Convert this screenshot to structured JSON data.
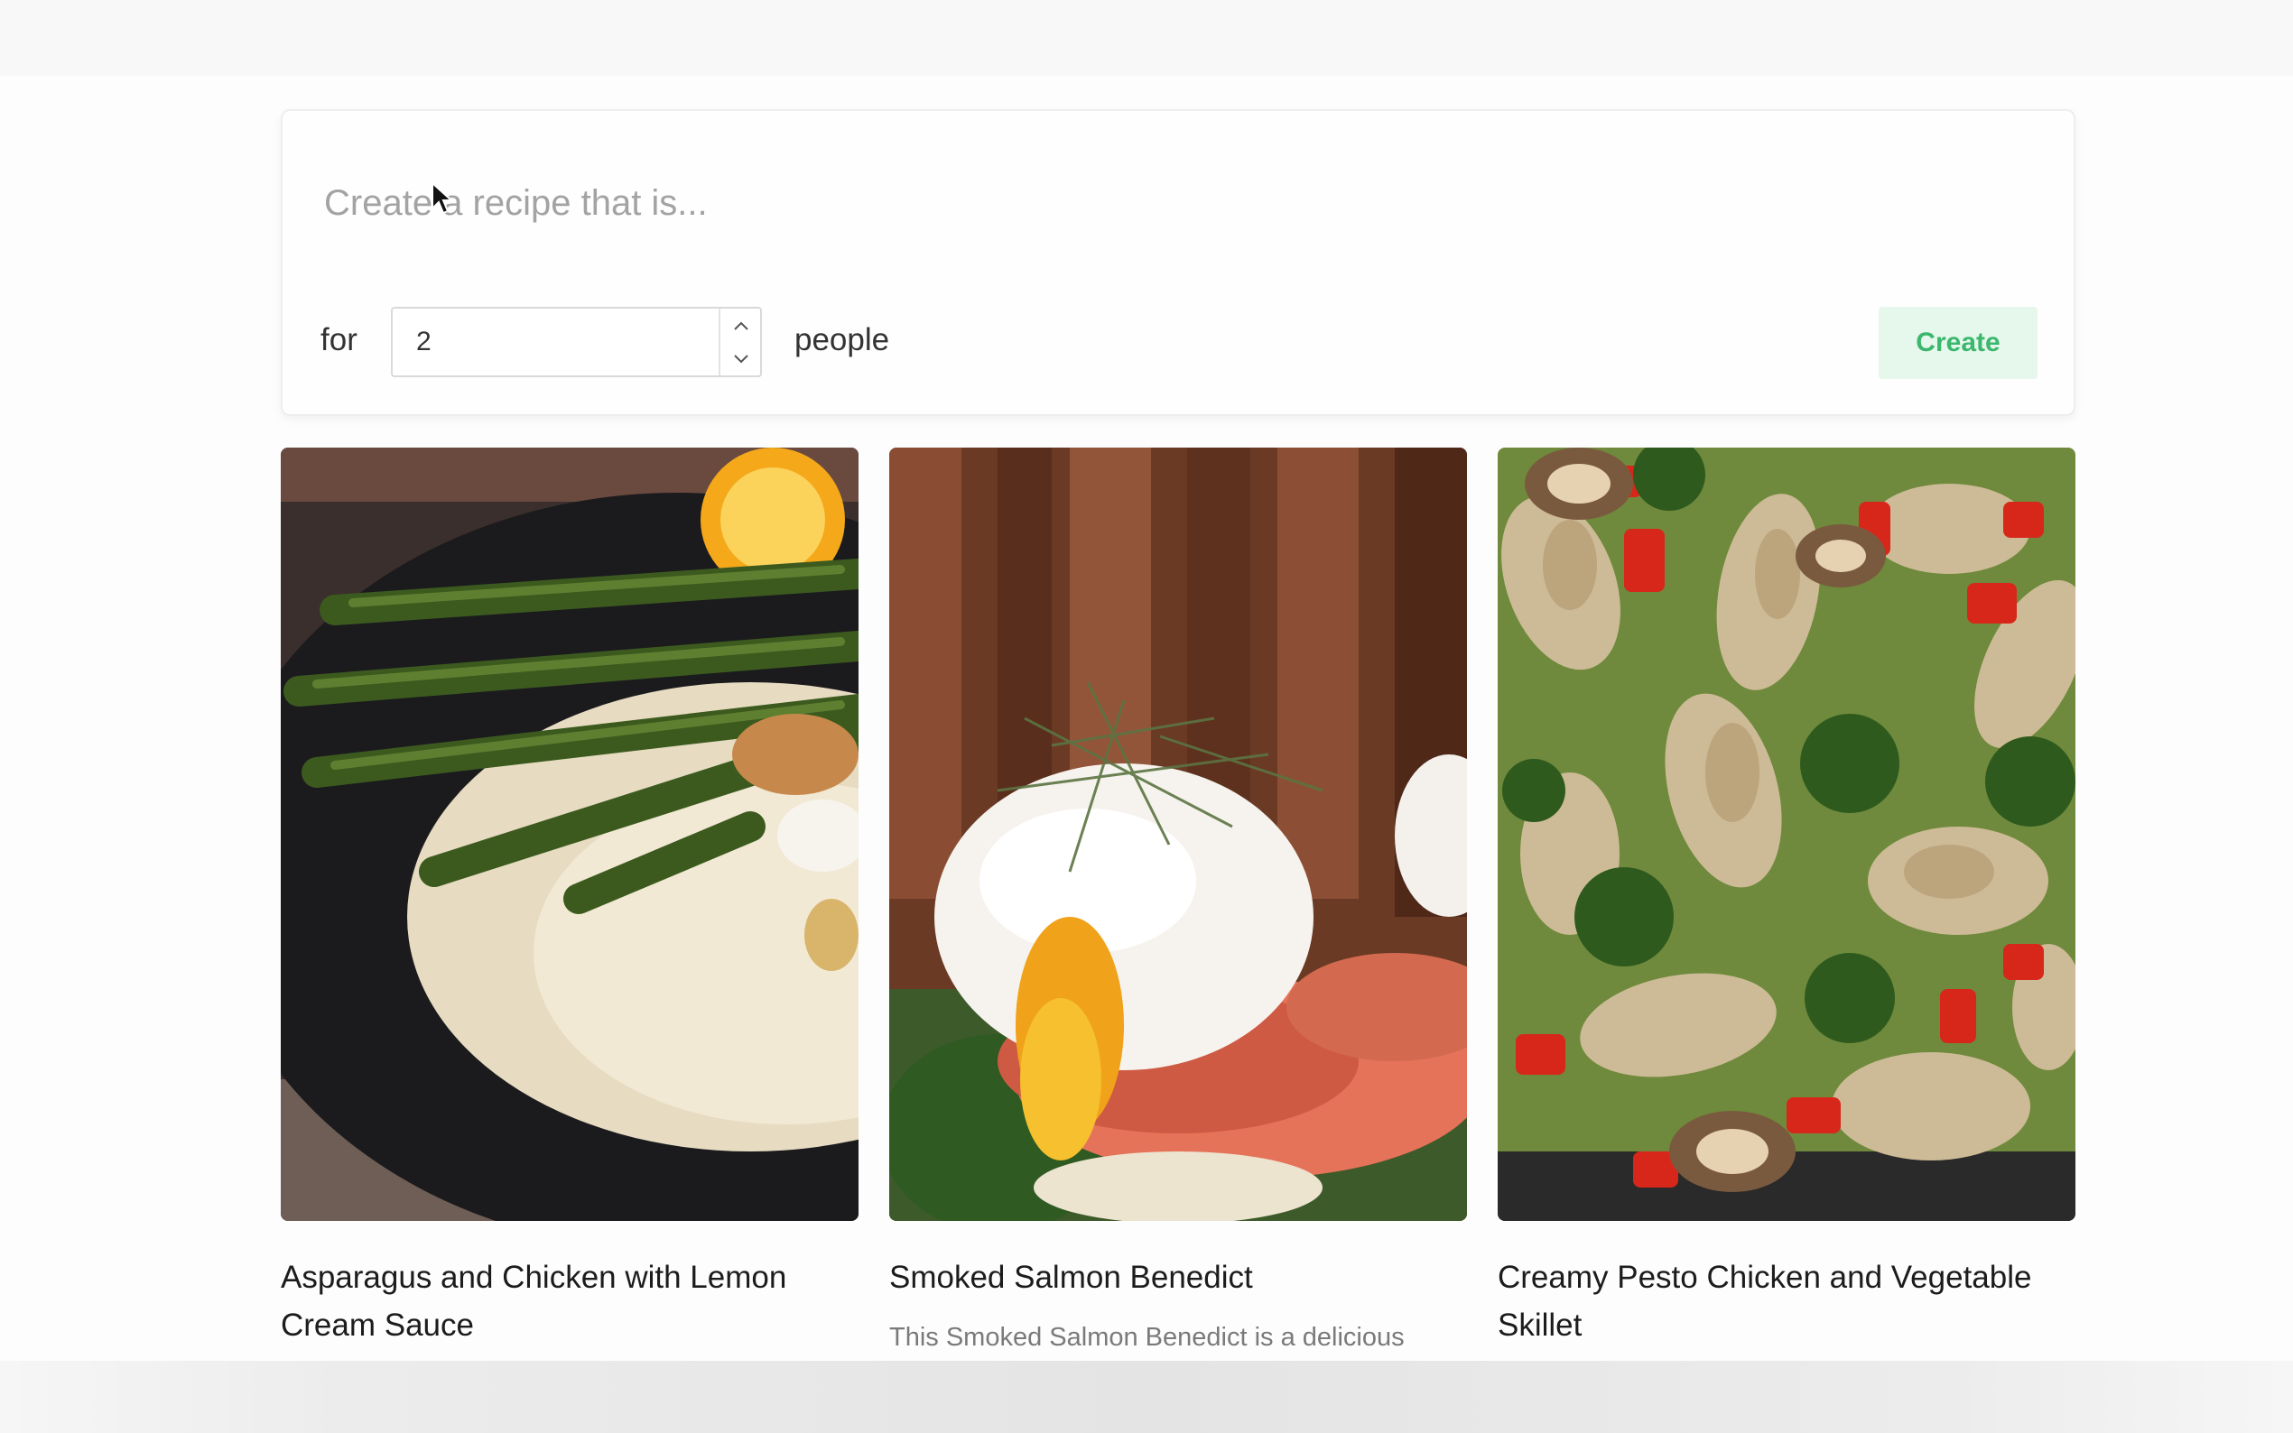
{
  "creator": {
    "prompt_placeholder": "Create a recipe that is...",
    "for_label": "for",
    "servings": "2",
    "people_label": "people",
    "create_label": "Create",
    "accent_color": "#3bb86d"
  },
  "recipes": [
    {
      "title": "Asparagus and Chicken with Lemon Cream Sauce",
      "description": "",
      "image": "asparagus-chicken-lemon-cream-photo"
    },
    {
      "title": "Smoked Salmon Benedict",
      "description": "This Smoked Salmon Benedict is a delicious",
      "image": "smoked-salmon-benedict-photo"
    },
    {
      "title": "Creamy Pesto Chicken and Vegetable Skillet",
      "description": "",
      "image": "pesto-chicken-skillet-photo"
    }
  ]
}
